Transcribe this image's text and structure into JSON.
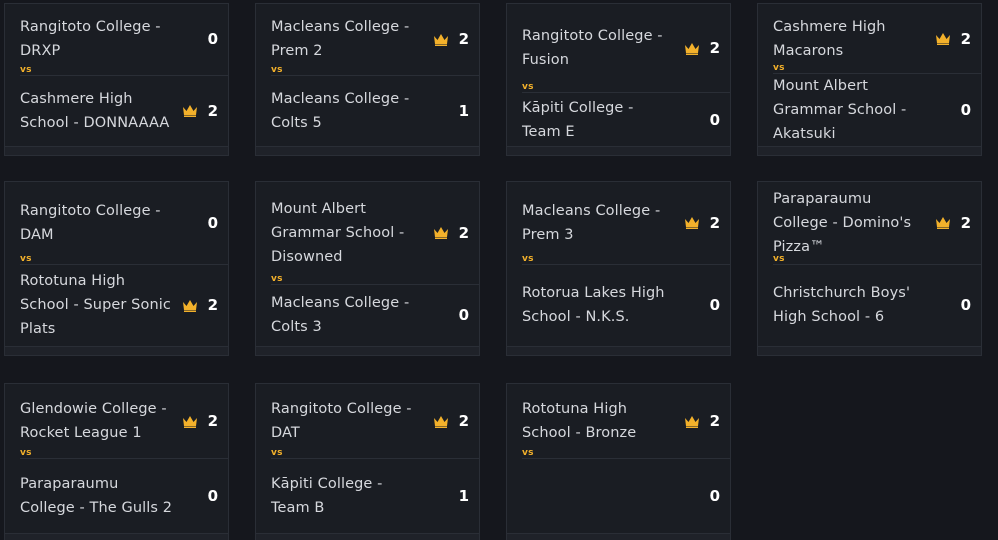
{
  "vs_label": "vs",
  "matches": [
    {
      "team1": "Rangitoto College - DRXP",
      "score1": "0",
      "team2": "Cashmere High School - DONNAAAA",
      "score2": "2",
      "winner": 2
    },
    {
      "team1": "Macleans College - Prem 2",
      "score1": "2",
      "team2": "Macleans College - Colts 5",
      "score2": "1",
      "winner": 1
    },
    {
      "team1": "Rangitoto College - Fusion",
      "score1": "2",
      "team2": "Kāpiti College - Team E",
      "score2": "0",
      "winner": 1
    },
    {
      "team1": "Cashmere High Macarons",
      "score1": "2",
      "team2": "Mount Albert Grammar School - Akatsuki",
      "score2": "0",
      "winner": 1
    },
    {
      "team1": "Rangitoto College - DAM",
      "score1": "0",
      "team2": "Rototuna High School - Super Sonic Plats",
      "score2": "2",
      "winner": 2
    },
    {
      "team1": "Mount Albert Grammar School - Disowned",
      "score1": "2",
      "team2": "Macleans College - Colts 3",
      "score2": "0",
      "winner": 1
    },
    {
      "team1": "Macleans College - Prem 3",
      "score1": "2",
      "team2": "Rotorua Lakes High School - N.K.S.",
      "score2": "0",
      "winner": 1
    },
    {
      "team1": "Paraparaumu College - Domino's Pizza™",
      "score1": "2",
      "team2": "Christchurch Boys' High School - 6",
      "score2": "0",
      "winner": 1
    },
    {
      "team1": "Glendowie College - Rocket League 1",
      "score1": "2",
      "team2": "Paraparaumu College - The Gulls 2",
      "score2": "0",
      "winner": 1
    },
    {
      "team1": "Rangitoto College - DAT",
      "score1": "2",
      "team2": "Kāpiti College - Team B",
      "score2": "1",
      "winner": 1
    },
    {
      "team1": "Rototuna High School - Bronze",
      "score1": "2",
      "team2": "",
      "score2": "0",
      "winner": 1
    }
  ],
  "colors": {
    "crown": "#f3b12b",
    "vs": "#f3b12b",
    "card_bg": "#1a1d23",
    "page_bg": "#15171d"
  }
}
